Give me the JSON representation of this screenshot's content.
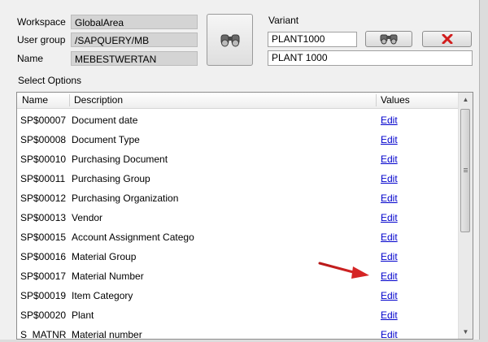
{
  "header": {
    "workspace_label": "Workspace",
    "workspace_value": "GlobalArea",
    "user_group_label": "User group",
    "user_group_value": "/SAPQUERY/MB",
    "name_label": "Name",
    "name_value": "MEBESTWERTAN",
    "find_button_icon": "binoculars-icon"
  },
  "variant": {
    "label": "Variant",
    "value": "PLANT1000",
    "description": "PLANT 1000",
    "search_icon": "binoculars-icon",
    "delete_icon": "red-x-icon"
  },
  "select_options": {
    "title": "Select Options",
    "columns": {
      "name": "Name",
      "description": "Description",
      "values": "Values"
    },
    "rows": [
      {
        "name": "SP$00007",
        "description": "Document date",
        "value": "Edit"
      },
      {
        "name": "SP$00008",
        "description": "Document Type",
        "value": "Edit"
      },
      {
        "name": "SP$00010",
        "description": "Purchasing Document",
        "value": "Edit"
      },
      {
        "name": "SP$00011",
        "description": "Purchasing Group",
        "value": "Edit"
      },
      {
        "name": "SP$00012",
        "description": "Purchasing Organization",
        "value": "Edit"
      },
      {
        "name": "SP$00013",
        "description": "Vendor",
        "value": "Edit"
      },
      {
        "name": "SP$00015",
        "description": "Account Assignment Catego",
        "value": "Edit"
      },
      {
        "name": "SP$00016",
        "description": "Material Group",
        "value": "Edit"
      },
      {
        "name": "SP$00017",
        "description": "Material Number",
        "value": "Edit"
      },
      {
        "name": "SP$00019",
        "description": "Item Category",
        "value": "Edit"
      },
      {
        "name": "SP$00020",
        "description": "Plant",
        "value": "Edit"
      },
      {
        "name": "S_MATNR",
        "description": "Material number",
        "value": "Edit"
      }
    ]
  },
  "annotation": {
    "arrow_color": "#cc1f1f",
    "points_to": "SP$00017 Edit"
  },
  "colors": {
    "link": "#0000cc",
    "readonly_bg": "#d4d4d4",
    "window_bg": "#f0f0f0"
  }
}
